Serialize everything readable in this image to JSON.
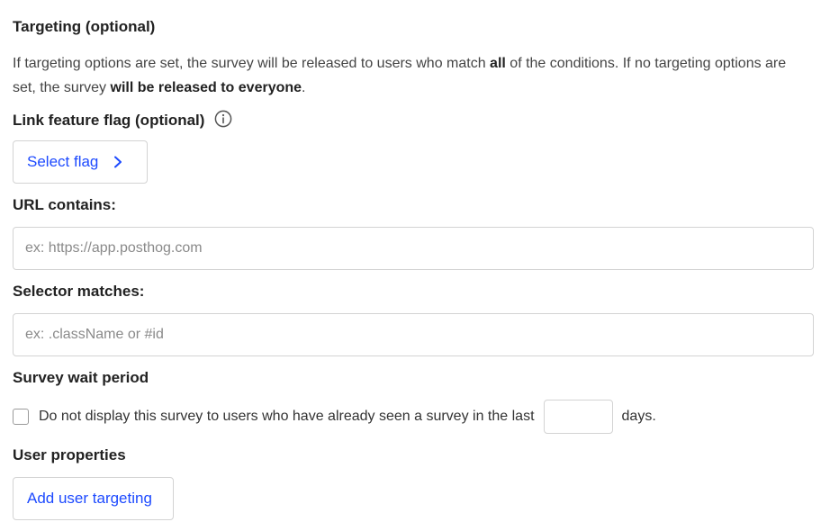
{
  "targeting": {
    "title": "Targeting (optional)",
    "desc_part1": "If targeting options are set, the survey will be released to users who match ",
    "desc_bold1": "all",
    "desc_part2": " of the conditions. If no targeting options are set, the survey ",
    "desc_bold2": "will be released to everyone",
    "desc_part3": "."
  },
  "feature_flag": {
    "label": "Link feature flag (optional)",
    "icon": "info-icon",
    "button_label": "Select flag",
    "button_icon": "chevron-right-icon"
  },
  "url": {
    "label": "URL contains:",
    "placeholder": "ex: https://app.posthog.com",
    "value": ""
  },
  "selector": {
    "label": "Selector matches:",
    "placeholder": "ex: .className or #id",
    "value": ""
  },
  "wait_period": {
    "label": "Survey wait period",
    "checkbox_text": "Do not display this survey to users who have already seen a survey in the last",
    "checked": false,
    "days_value": "",
    "days_suffix": "days."
  },
  "user_properties": {
    "label": "User properties",
    "button_label": "Add user targeting"
  },
  "colors": {
    "accent": "#1d4aff",
    "border": "#d3d3d3"
  }
}
